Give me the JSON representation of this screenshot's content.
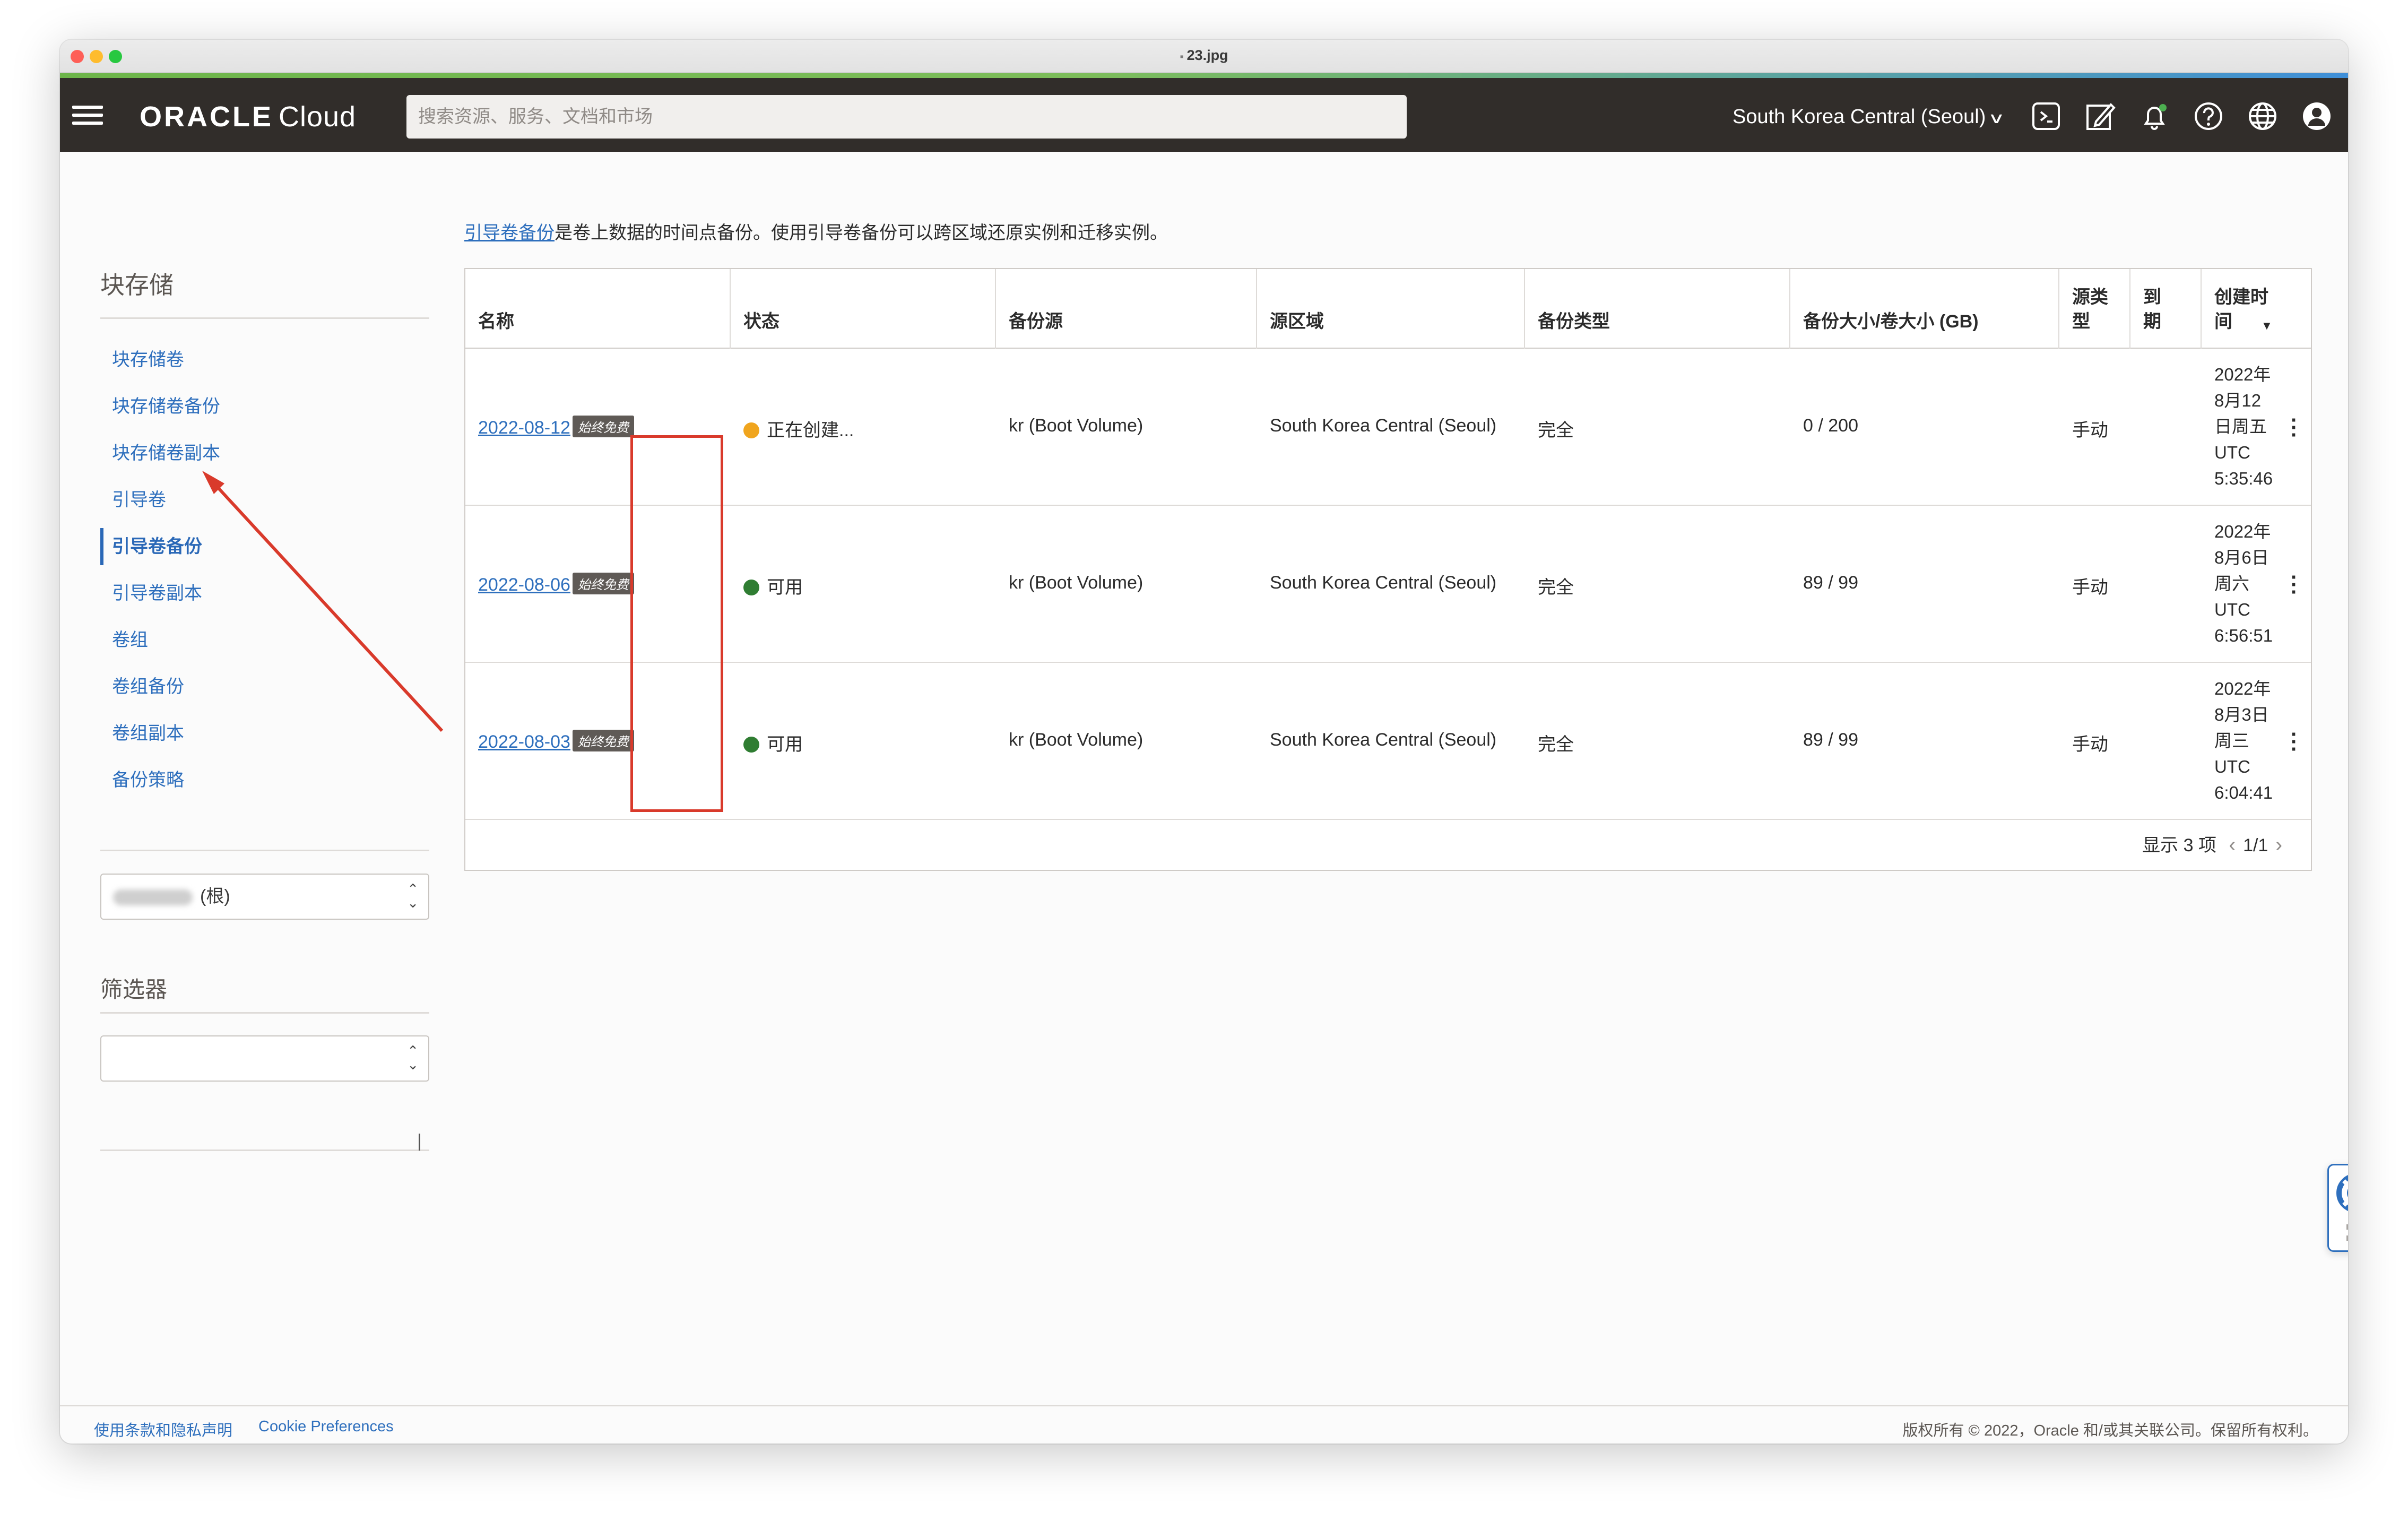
{
  "window": {
    "title": "23.jpg"
  },
  "nav": {
    "logo_brand": "ORACLE",
    "logo_product": "Cloud",
    "search_placeholder": "搜索资源、服务、文档和市场",
    "region": "South Korea Central (Seoul)",
    "icons": [
      "cloud-shell-icon",
      "edit-icon",
      "notification-bell-icon",
      "help-icon",
      "language-globe-icon",
      "profile-icon"
    ]
  },
  "sidebar": {
    "title": "块存储",
    "items": [
      {
        "label": "块存储卷"
      },
      {
        "label": "块存储卷备份"
      },
      {
        "label": "块存储卷副本"
      },
      {
        "label": "引导卷"
      },
      {
        "label": "引导卷备份",
        "active": true
      },
      {
        "label": "引导卷副本"
      },
      {
        "label": "卷组"
      },
      {
        "label": "卷组备份"
      },
      {
        "label": "卷组副本"
      },
      {
        "label": "备份策略"
      }
    ],
    "compartment_suffix": "(根)",
    "filter_title": "筛选器",
    "filter_value": ""
  },
  "main": {
    "desc_link": "引导卷备份",
    "desc_text": "是卷上数据的时间点备份。使用引导卷备份可以跨区域还原实例和迁移实例。",
    "columns": [
      "名称",
      "状态",
      "备份源",
      "源区域",
      "备份类型",
      "备份大小/卷大小 (GB)",
      "源类\n型",
      "到\n期",
      "创建时\n间"
    ],
    "rows": [
      {
        "name": "2022-08-12",
        "badge": "始终免费",
        "status": "正在创建...",
        "status_color": "#f0a51e",
        "source": "kr (Boot Volume)",
        "region": "South Korea Central (Seoul)",
        "type": "完全",
        "size": "0 / 200",
        "source_type": "手动",
        "created": [
          "2022年",
          "8月12",
          "日周五",
          "UTC",
          "5:35:46"
        ]
      },
      {
        "name": "2022-08-06",
        "badge": "始终免费",
        "status": "可用",
        "status_color": "#2f7d32",
        "source": "kr (Boot Volume)",
        "region": "South Korea Central (Seoul)",
        "type": "完全",
        "size": "89 / 99",
        "source_type": "手动",
        "created": [
          "2022年",
          "8月6日",
          "周六",
          "UTC",
          "6:56:51"
        ]
      },
      {
        "name": "2022-08-03",
        "badge": "始终免费",
        "status": "可用",
        "status_color": "#2f7d32",
        "source": "kr (Boot Volume)",
        "region": "South Korea Central (Seoul)",
        "type": "完全",
        "size": "89 / 99",
        "source_type": "手动",
        "created": [
          "2022年",
          "8月3日",
          "周三",
          "UTC",
          "6:04:41"
        ]
      }
    ],
    "pager_count": "显示 3 项",
    "pager_page": "1/1"
  },
  "footer": {
    "terms": "使用条款和隐私声明",
    "cookies": "Cookie Preferences",
    "copyright": "版权所有 © 2022，Oracle 和/或其关联公司。保留所有权利。"
  },
  "colors": {
    "nav_bg": "#312d2a",
    "link": "#2e6fbd",
    "annotation": "#d93a2b"
  }
}
